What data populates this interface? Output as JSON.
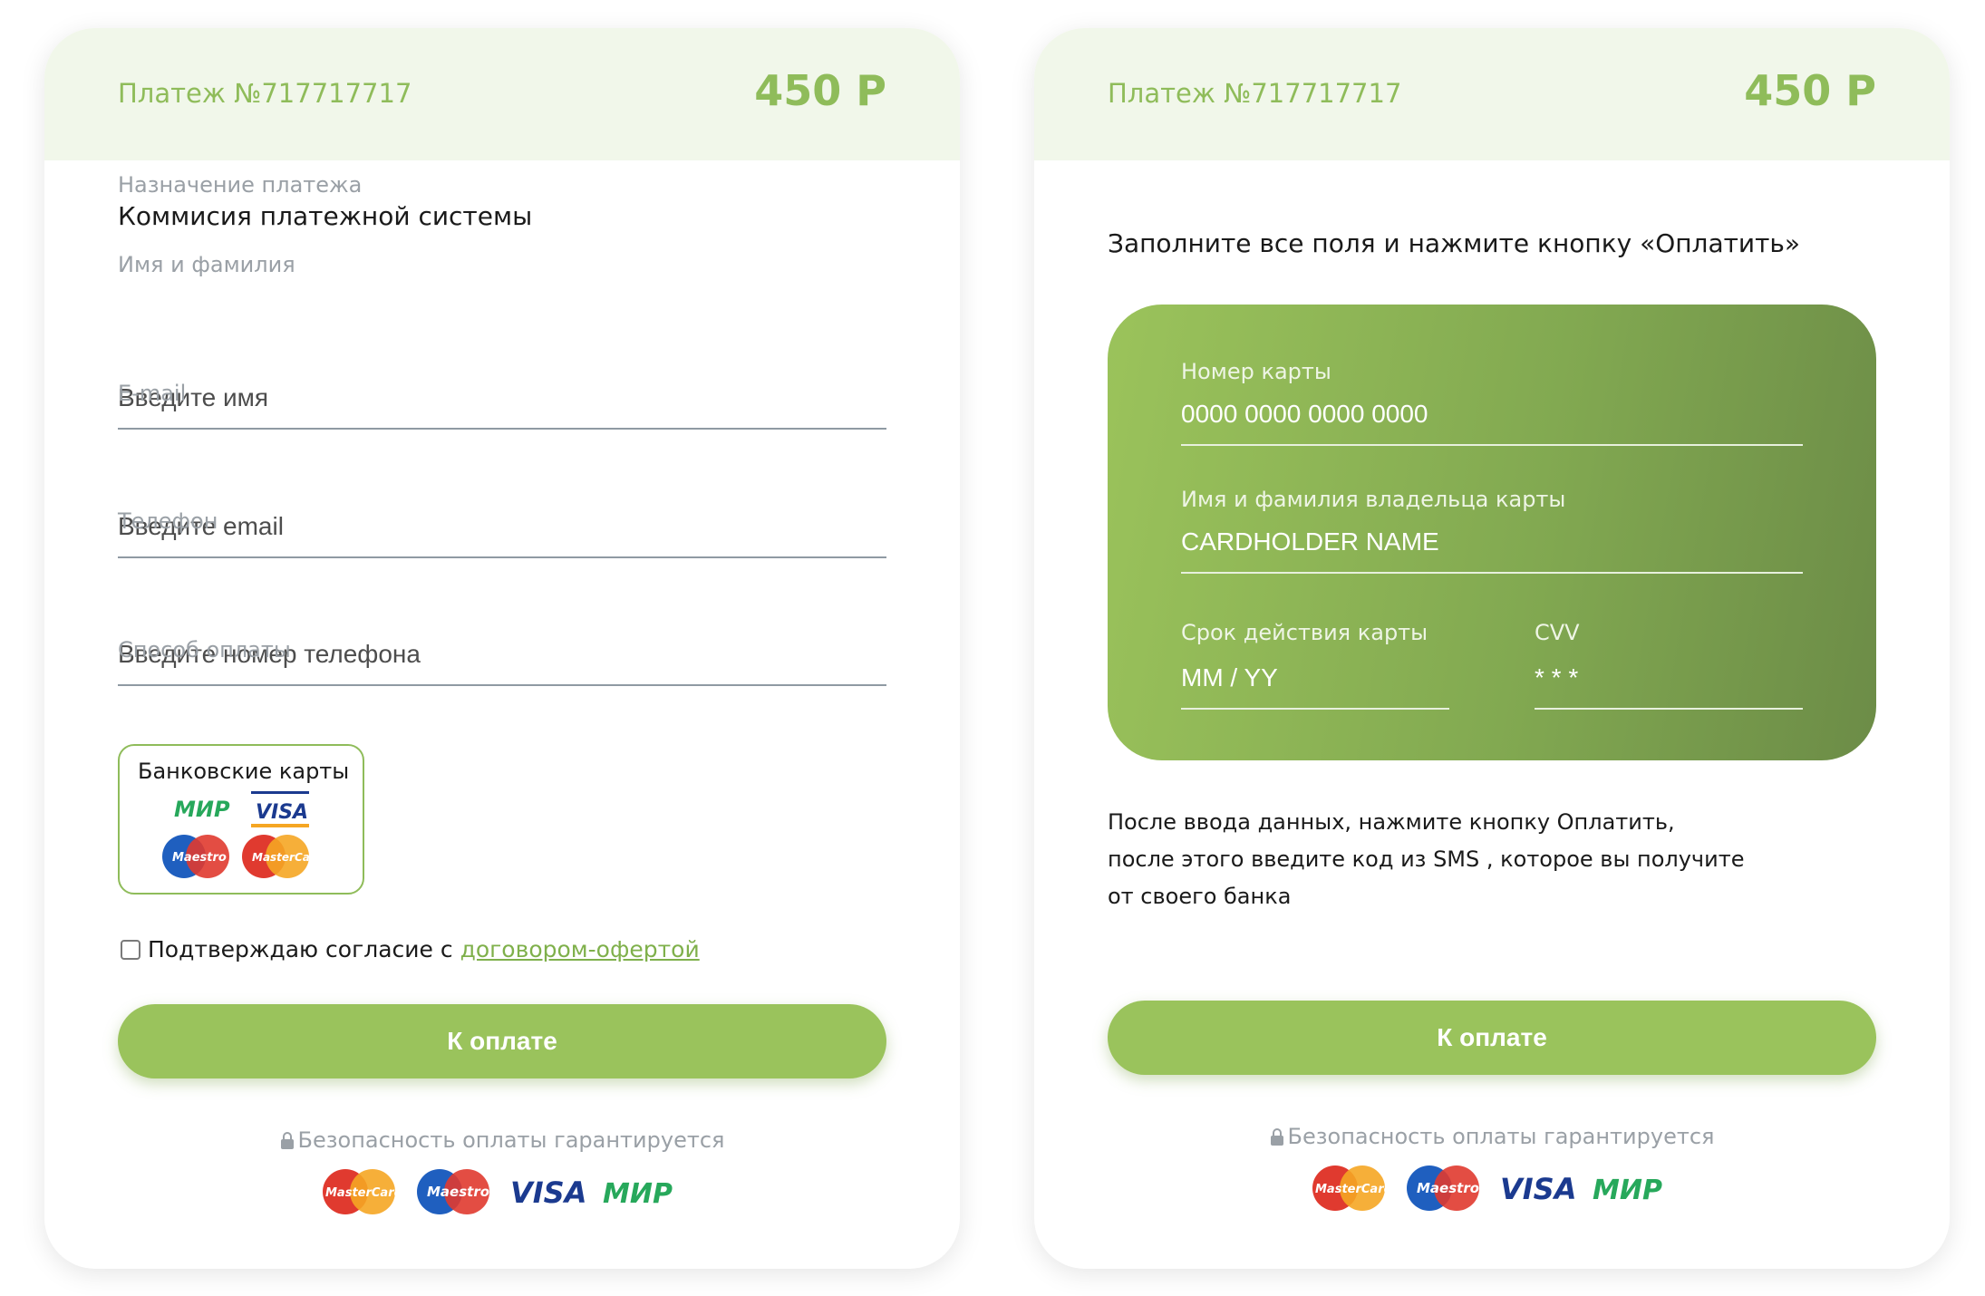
{
  "left_card": {
    "payment_number": "Платеж №717717717",
    "amount": "450 Р",
    "purpose_label": "Назначение платежа",
    "purpose_value": "Коммисия платежной системы",
    "name_label": "Имя и фамилия",
    "name_placeholder": "Введите имя",
    "email_label": "E-mail",
    "email_placeholder": "Введите email",
    "phone_label": "Телефон",
    "phone_placeholder": "Введите номер телефона",
    "method_label": "Способ оплаты",
    "method_option": "Банковские карты",
    "agree_text": "Подтверждаю согласие с",
    "agree_link": "договором-офертой",
    "pay_button": "К оплате",
    "secure_text": "Безопасность оплаты гарантируется"
  },
  "right_card": {
    "payment_number": "Платеж №717717717",
    "amount": "450 Р",
    "instruction": "Заполните все поля и нажмите кнопку «Оплатить»",
    "card_number_label": "Номер карты",
    "card_number_placeholder": "0000 0000 0000 0000",
    "holder_label": "Имя и фамилия владельца карты",
    "holder_placeholder": "CARDHOLDER NAME",
    "expiry_label": "Срок действия карты",
    "expiry_placeholder": "MM / YY",
    "cvv_label": "CVV",
    "cvv_placeholder": "* * *",
    "note_lines": [
      "После ввода данных, нажмите кнопку Оплатить,",
      "после этого введите код из SMS , которое вы получите",
      "от своего банка"
    ],
    "pay_button": "К оплате",
    "secure_text": "Безопасность оплаты гарантируется"
  },
  "brands": {
    "mastercard": "MasterCard",
    "maestro": "Maestro",
    "visa": "VISA",
    "mir": "МИР"
  },
  "colors": {
    "accent": "#9ac35c",
    "header_bg": "#f1f7ea",
    "header_text": "#8fbc5a",
    "link": "#7fb04b"
  }
}
